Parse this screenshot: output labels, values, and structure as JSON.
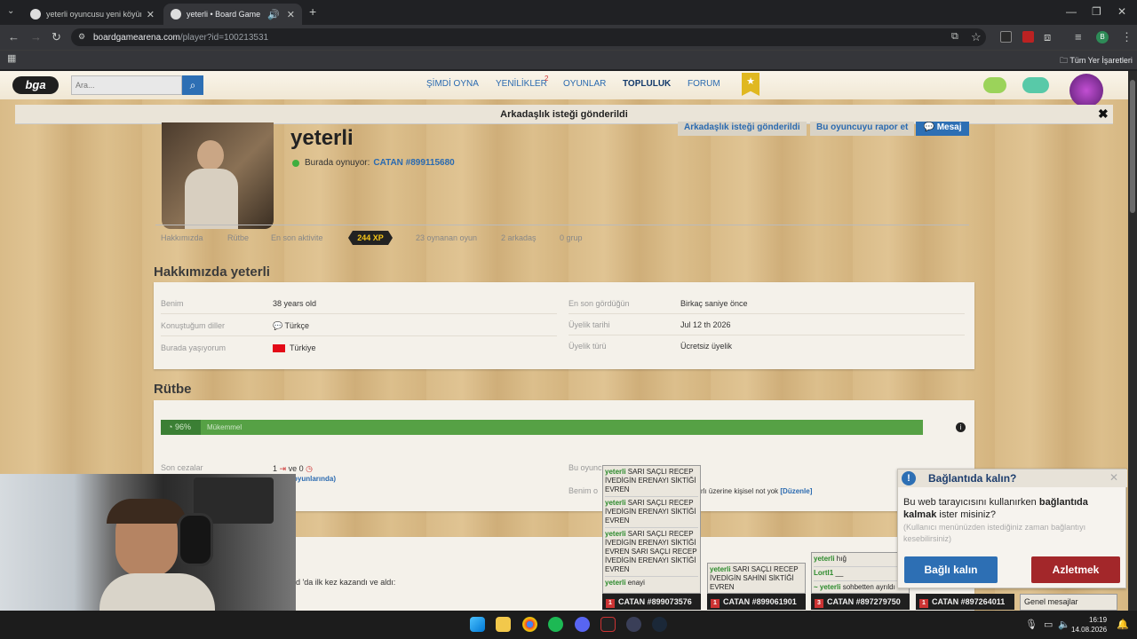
{
  "browser": {
    "tabs": [
      {
        "title": "yeterli oyuncusu yeni köyünü k",
        "active": false
      },
      {
        "title": "yeterli • Board Game Arena",
        "active": true
      }
    ],
    "url_host": "boardgamearena.com",
    "url_path": "/player?id=100213531",
    "bookmarks_all": "Tüm Yer İşaretleri"
  },
  "header": {
    "logo": "bga",
    "search_placeholder": "Ara...",
    "nav": [
      "ŞİMDİ OYNA",
      "YENİLİKLER",
      "OYUNLAR",
      "TOPLULUK",
      "FORUM"
    ],
    "news_badge": "2"
  },
  "notification": "Arkadaşlık isteği gönderildi",
  "profile": {
    "name": "yeterli",
    "status_prefix": "Burada oynuyor:",
    "status_game": "CATAN #899115680",
    "buttons": [
      "Arkadaşlık isteği gönderildi",
      "Bu oyuncuyu rapor et",
      "Mesaj"
    ],
    "tabs": [
      "Hakkımızda",
      "Rütbe",
      "En son aktivite",
      "244 XP",
      "23 oynanan oyun",
      "2 arkadaş",
      "0 grup"
    ]
  },
  "about": {
    "title": "Hakkımızda yeterli",
    "left": [
      {
        "label": "Benim",
        "value": "38 years old"
      },
      {
        "label": "Konuştuğum diller",
        "value": "Türkçe"
      },
      {
        "label": "Burada yaşıyorum",
        "value": "Türkiye"
      }
    ],
    "right": [
      {
        "label": "En son gördüğün",
        "value": "Birkaç saniye önce"
      },
      {
        "label": "Üyelik tarihi",
        "value": "Jul 12 th 2026"
      },
      {
        "label": "Üyelik türü",
        "value": "Ücretsiz üyelik"
      }
    ]
  },
  "rank": {
    "title": "Rütbe",
    "percent_text": "96%",
    "percent_value": 96,
    "level": "Mükemmel",
    "penalties_label": "Son cezalar",
    "penalties_a": "1",
    "penalties_mid": "ve 0",
    "penalties_sub": "oyunlarında)",
    "this_player": "Bu oyunc",
    "note_label": "Benim o",
    "note_text": "rlı üzerine kişisel not yok",
    "edit": "[Düzenle]",
    "won_text": "d 'da ilk kez kazandı ve aldı:"
  },
  "chats": [
    {
      "messages": [
        {
          "user": "yeterli",
          "text": " SARI SAÇLI RECEP İVEDİGİN ERENAYI SİKTİĞİ EVREN"
        },
        {
          "user": "yeterli",
          "text": " SARI SAÇLI RECEP İVEDİGİN ERENAYI SİKTİĞİ EVREN"
        },
        {
          "user": "yeterli",
          "text": " SARI SAÇLI RECEP İVEDİGİN ERENAYI SİKTİĞİ EVREN SARI SAÇLI RECEP İVEDİGİN ERENAYI SİKTİĞİ EVREN"
        },
        {
          "user": "yeterli",
          "text": " enayi"
        }
      ],
      "bar": "CATAN #899073576",
      "count": "1"
    },
    {
      "messages": [
        {
          "user": "yeterli",
          "text": " SARI SAÇLI RECEP İVEDİGİN SAHİNİ SİKTİĞİ EVREN"
        }
      ],
      "bar": "CATAN #899061901",
      "count": "1"
    },
    {
      "messages": [
        {
          "user": "yeterli",
          "text": " hığ"
        },
        {
          "user": "Lortl1",
          "text": " __"
        },
        {
          "user": "~ yeterli",
          "text": " sohbetten ayrıldı"
        }
      ],
      "bar": "CATAN #897279750",
      "count": "3"
    },
    {
      "messages": [],
      "bar": "CATAN #897264011",
      "count": "1"
    }
  ],
  "general_messages": "Genel mesajlar",
  "popup": {
    "title": "Bağlantıda kalın?",
    "body_pre": "Bu web tarayıcısını kullanırken ",
    "body_bold": "bağlantıda kalmak",
    "body_post": " ister misiniz?",
    "hint": "(Kullanıcı menünüzden istediğiniz zaman bağlantıyı kesebilirsiniz)",
    "stay": "Bağlı kalın",
    "leave": "Azletmek"
  },
  "clock": {
    "time": "16:19",
    "date": "14.08.2026"
  },
  "colors": {
    "accent": "#2d6fb4",
    "rank_bar": "#56a145",
    "danger": "#a3272a"
  }
}
